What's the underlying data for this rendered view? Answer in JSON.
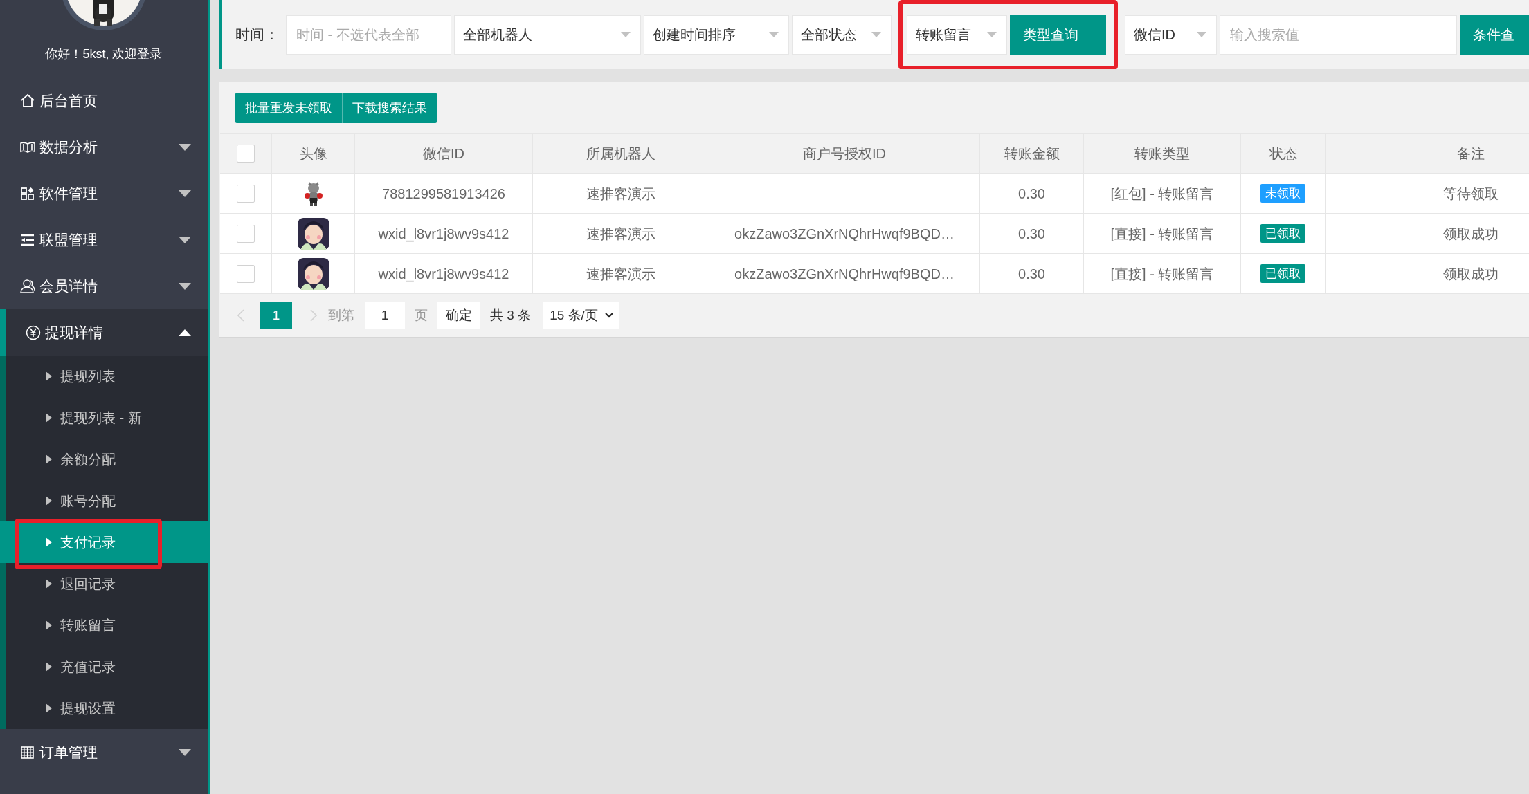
{
  "sidebar": {
    "greeting": "你好！5kst, 欢迎登录",
    "items": [
      {
        "label": "后台首页",
        "kind": "link",
        "expanded": false
      },
      {
        "label": "数据分析",
        "kind": "group",
        "expanded": false
      },
      {
        "label": "软件管理",
        "kind": "group",
        "expanded": false
      },
      {
        "label": "联盟管理",
        "kind": "group",
        "expanded": false
      },
      {
        "label": "会员详情",
        "kind": "group",
        "expanded": false
      },
      {
        "label": "提现详情",
        "kind": "group",
        "expanded": true,
        "children": [
          {
            "label": "提现列表",
            "selected": false,
            "highlighted": false
          },
          {
            "label": "提现列表 - 新",
            "selected": false,
            "highlighted": false
          },
          {
            "label": "余额分配",
            "selected": false,
            "highlighted": false
          },
          {
            "label": "账号分配",
            "selected": false,
            "highlighted": false
          },
          {
            "label": "支付记录",
            "selected": true,
            "highlighted": true
          },
          {
            "label": "退回记录",
            "selected": false,
            "highlighted": false
          },
          {
            "label": "转账留言",
            "selected": false,
            "highlighted": false
          },
          {
            "label": "充值记录",
            "selected": false,
            "highlighted": false
          },
          {
            "label": "提现设置",
            "selected": false,
            "highlighted": false
          }
        ]
      },
      {
        "label": "订单管理",
        "kind": "group",
        "expanded": false
      }
    ]
  },
  "toolbar": {
    "label": "时间：",
    "controls": [
      {
        "kind": "date-field",
        "placeholder": "时间 - 不选代表全部",
        "highlighted": false
      },
      {
        "kind": "select",
        "value": "全部机器人",
        "highlighted": false
      },
      {
        "kind": "select",
        "value": "创建时间排序",
        "highlighted": false
      },
      {
        "kind": "select",
        "value": "全部状态",
        "highlighted": false
      },
      {
        "kind": "select",
        "value": "转账留言",
        "highlighted": true
      },
      {
        "kind": "button",
        "label": "类型查询",
        "highlighted": true
      },
      {
        "kind": "select",
        "value": "微信ID",
        "highlighted": false
      },
      {
        "kind": "search-field",
        "placeholder": "输入搜索值",
        "highlighted": false
      },
      {
        "kind": "button",
        "label": "条件查",
        "highlighted": false
      }
    ]
  },
  "actions": [
    "批量重发未领取",
    "下载搜索结果"
  ],
  "table": {
    "all_checked": false,
    "columns": [
      "头像",
      "微信ID",
      "所属机器人",
      "商户号授权ID",
      "转账金额",
      "转账类型",
      "状态",
      "备注"
    ],
    "rows": [
      {
        "checked": false,
        "wechat_id": "7881299581913426",
        "robot": "速推客演示",
        "merchant_auth_id": "",
        "amount": "0.30",
        "type": "[红包] - 转账留言",
        "status": {
          "text": "未领取",
          "color": "#1e9fff"
        },
        "remark": "等待领取"
      },
      {
        "checked": false,
        "wechat_id": "wxid_l8vr1j8wv9s412",
        "robot": "速推客演示",
        "merchant_auth_id": "okzZawo3ZGnXrNQhrHwqf9BQD…",
        "amount": "0.30",
        "type": "[直接] - 转账留言",
        "status": {
          "text": "已领取",
          "color": "#009688"
        },
        "remark": "领取成功"
      },
      {
        "checked": false,
        "wechat_id": "wxid_l8vr1j8wv9s412",
        "robot": "速推客演示",
        "merchant_auth_id": "okzZawo3ZGnXrNQhrHwqf9BQD…",
        "amount": "0.30",
        "type": "[直接] - 转账留言",
        "status": {
          "text": "已领取",
          "color": "#009688"
        },
        "remark": "领取成功"
      }
    ]
  },
  "pagination": {
    "pages": [
      {
        "label": "1",
        "selected": true
      }
    ],
    "goto_label": "到第",
    "goto_value": "1",
    "page_suffix": "页",
    "confirm": "确定",
    "total": "共 3 条",
    "page_size": "15 条/页"
  }
}
